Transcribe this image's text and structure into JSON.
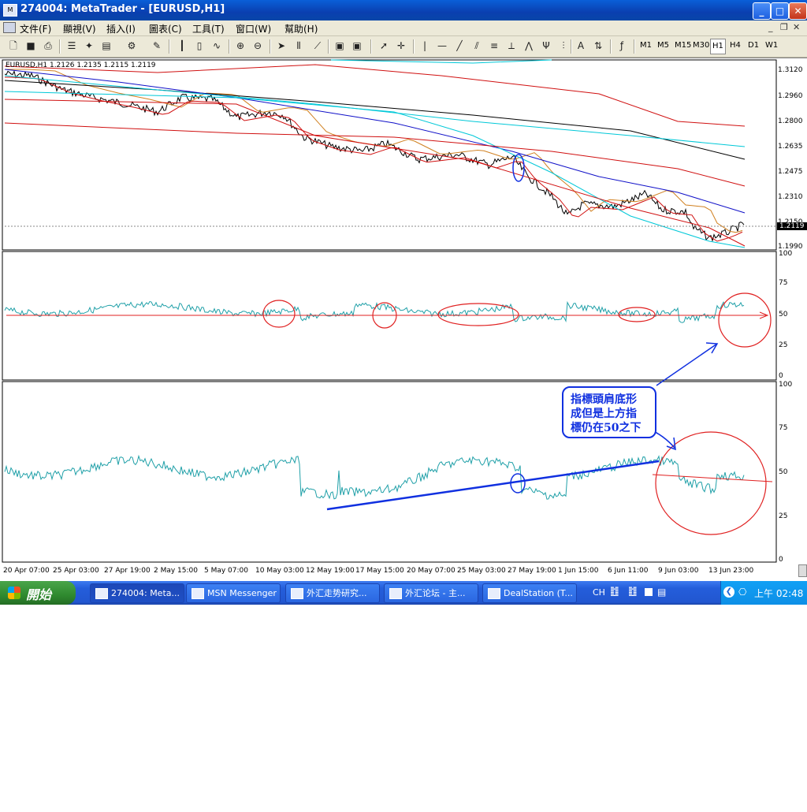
{
  "window": {
    "title": "274004: MetaTrader - [EURUSD,H1]",
    "icon": "metatrader-app-icon",
    "minimize": "_",
    "maximize": "□",
    "close": "✕",
    "mdi_controls": [
      "_",
      "❐",
      "✕"
    ]
  },
  "menu": {
    "items": [
      "文件(F)",
      "顯視(V)",
      "插入(I)",
      "圖表(C)",
      "工具(T)",
      "窗口(W)",
      "幫助(H)"
    ]
  },
  "toolbar": {
    "timeframes": [
      "M1",
      "M5",
      "M15",
      "M30",
      "H1",
      "H4",
      "D1",
      "W1"
    ],
    "active_timeframe": "H1",
    "icons": [
      "new-file-icon",
      "save-icon",
      "print-icon",
      "print-preview-icon",
      "properties-icon",
      "expert-icon",
      "bar-chart-icon",
      "candle-chart-icon",
      "line-chart-icon",
      "zoom-in-icon",
      "zoom-out-icon",
      "auto-scroll-icon",
      "chart-shift-icon",
      "template-icon",
      "periodicity-icon",
      "cursor-icon",
      "crosshair-icon",
      "vertical-line-icon",
      "horizontal-line-icon",
      "trendline-icon",
      "channel-icon",
      "fibonacci-icon",
      "pitchfork-icon",
      "text-icon",
      "arrows-icon",
      "indicators-icon"
    ]
  },
  "chart": {
    "symbol_info": "EURUSD,H1  1.2126 1.2135 1.2115 1.2119",
    "price_ticks": [
      "1.3120",
      "1.2960",
      "1.2800",
      "1.2635",
      "1.2475",
      "1.2310",
      "1.2150",
      "1.1990"
    ],
    "current_price": "1.2119",
    "indicator1_ticks": [
      "100",
      "75",
      "50",
      "25",
      "0"
    ],
    "indicator2_ticks": [
      "100",
      "75",
      "50",
      "25",
      "0"
    ],
    "time_labels": [
      "20 Apr 07:00",
      "25 Apr 03:00",
      "27 Apr 19:00",
      "2 May 15:00",
      "5 May 07:00",
      "10 May 03:00",
      "12 May 19:00",
      "17 May 15:00",
      "20 May 07:00",
      "25 May 03:00",
      "27 May 19:00",
      "1 Jun 15:00",
      "6 Jun 11:00",
      "9 Jun 03:00",
      "13 Jun 23:00"
    ],
    "annotation_lines": [
      "指標頭肩底形",
      "成但是上方指",
      "標仍在50之下"
    ],
    "colors": {
      "price": "#000000",
      "ma_red": "#d01010",
      "ma_blue": "#1010c8",
      "ma_cyan": "#00c8d8",
      "ma_orange": "#d08020",
      "indicator": "#20a0a8",
      "markup_red": "#e02020",
      "markup_blue": "#1030e0"
    }
  },
  "taskbar": {
    "start_label": "開始",
    "tasks": [
      "274004: Meta...",
      "MSN Messenger",
      "外汇走势研究...",
      "外汇论坛 - 主...",
      "DealStation (T..."
    ],
    "lang": "CH",
    "clock": "上午 02:48"
  }
}
